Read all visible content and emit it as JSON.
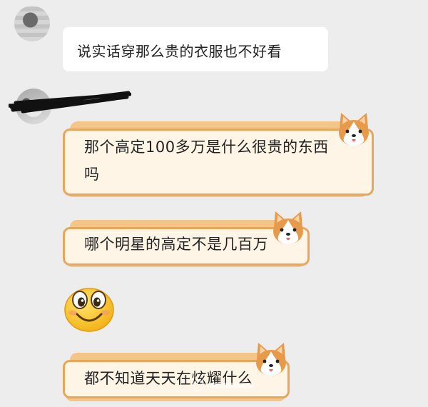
{
  "messages": [
    {
      "id": "m1",
      "text": "说实话穿那么贵的衣服也不好看"
    },
    {
      "id": "m2",
      "line1": "那个高定100多万是什么很贵的东西",
      "line2": "吗"
    },
    {
      "id": "m3",
      "text": "哪个明星的高定不是几百万"
    },
    {
      "id": "m4",
      "emoji": "smiling-face"
    },
    {
      "id": "m5",
      "text": "都不知道天天在炫耀什么"
    }
  ],
  "bubble_colors": {
    "plain": "#ffffff",
    "dog_panel": "#fff5e6",
    "dog_border": "#e8a65b",
    "dog_roll": "#f3c589",
    "background": "#ededed"
  }
}
